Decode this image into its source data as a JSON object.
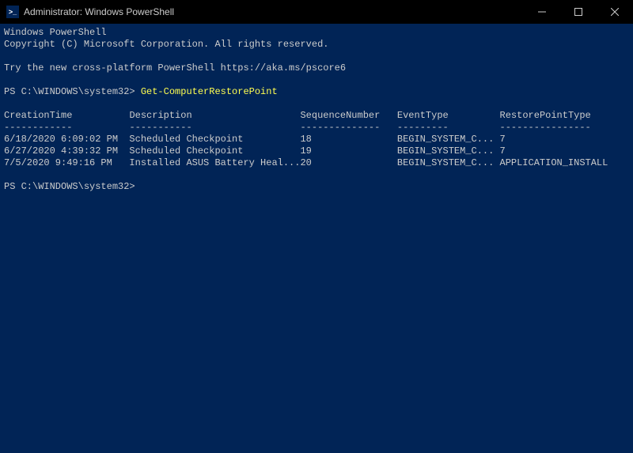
{
  "titlebar": {
    "icon_text": ">_",
    "title": "Administrator: Windows PowerShell"
  },
  "terminal": {
    "header_line1": "Windows PowerShell",
    "header_line2": "Copyright (C) Microsoft Corporation. All rights reserved.",
    "try_line": "Try the new cross-platform PowerShell https://aka.ms/pscore6",
    "prompt1_path": "PS C:\\WINDOWS\\system32> ",
    "prompt1_command": "Get-ComputerRestorePoint",
    "table": {
      "headers": {
        "col0": "CreationTime",
        "col1": "Description",
        "col2": "SequenceNumber",
        "col3": "EventType",
        "col4": "RestorePointType"
      },
      "dividers": {
        "col0": "------------",
        "col1": "-----------",
        "col2": "--------------",
        "col3": "---------",
        "col4": "----------------"
      },
      "rows": [
        {
          "creation_time": "6/18/2020 6:09:02 PM",
          "description": "Scheduled Checkpoint",
          "sequence_number": "18",
          "event_type": "BEGIN_SYSTEM_C...",
          "restore_point_type": "7"
        },
        {
          "creation_time": "6/27/2020 4:39:32 PM",
          "description": "Scheduled Checkpoint",
          "sequence_number": "19",
          "event_type": "BEGIN_SYSTEM_C...",
          "restore_point_type": "7"
        },
        {
          "creation_time": "7/5/2020 9:49:16 PM",
          "description": "Installed ASUS Battery Heal...",
          "sequence_number": "20",
          "event_type": "BEGIN_SYSTEM_C...",
          "restore_point_type": "APPLICATION_INSTALL"
        }
      ]
    },
    "prompt2_path": "PS C:\\WINDOWS\\system32>",
    "cursor": "_"
  }
}
